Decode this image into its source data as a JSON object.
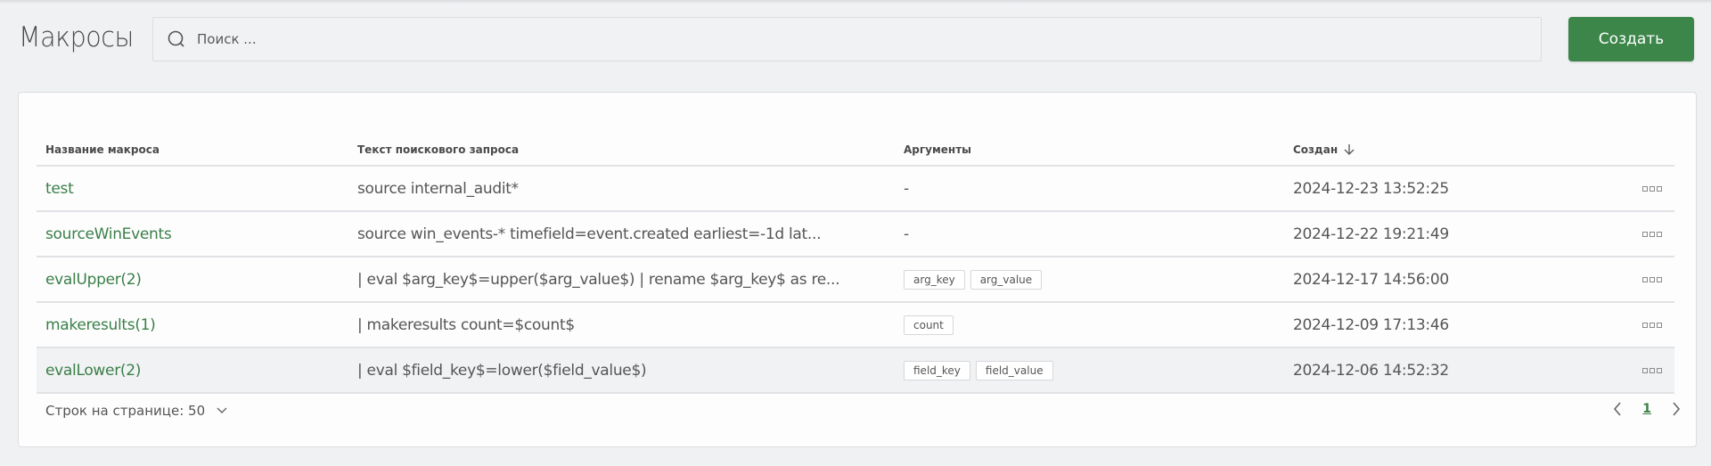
{
  "header": {
    "title": "Макросы",
    "search_placeholder": "Поиск ...",
    "search_value": "",
    "create_label": "Создать"
  },
  "table": {
    "columns": [
      "Название макроса",
      "Текст поискового запроса",
      "Аргументы",
      "Создан"
    ],
    "sort": {
      "column": "Создан",
      "direction": "desc",
      "icon": "arrow-down-icon"
    },
    "rows": [
      {
        "name": "test",
        "query": "source internal_audit*",
        "args": [],
        "args_empty": "-",
        "created": "2024-12-23 13:52:25"
      },
      {
        "name": "sourceWinEvents",
        "query": "source win_events-* timefield=event.created earliest=-1d lat...",
        "args": [],
        "args_empty": "-",
        "created": "2024-12-22 19:21:49"
      },
      {
        "name": "evalUpper(2)",
        "query": "| eval $arg_key$=upper($arg_value$) | rename $arg_key$ as re...",
        "args": [
          "arg_key",
          "arg_value"
        ],
        "args_empty": "",
        "created": "2024-12-17 14:56:00"
      },
      {
        "name": "makeresults(1)",
        "query": "| makeresults count=$count$",
        "args": [
          "count"
        ],
        "args_empty": "",
        "created": "2024-12-09 17:13:46"
      },
      {
        "name": "evalLower(2)",
        "query": "| eval $field_key$=lower($field_value$)",
        "args": [
          "field_key",
          "field_value"
        ],
        "args_empty": "",
        "created": "2024-12-06 14:52:32",
        "highlighted": true
      }
    ]
  },
  "footer": {
    "rows_per_page_label": "Строк на странице: 50",
    "current_page": "1"
  },
  "colors": {
    "accent": "#3c864a",
    "link": "#3a7f47",
    "background": "#f0f1f3"
  }
}
